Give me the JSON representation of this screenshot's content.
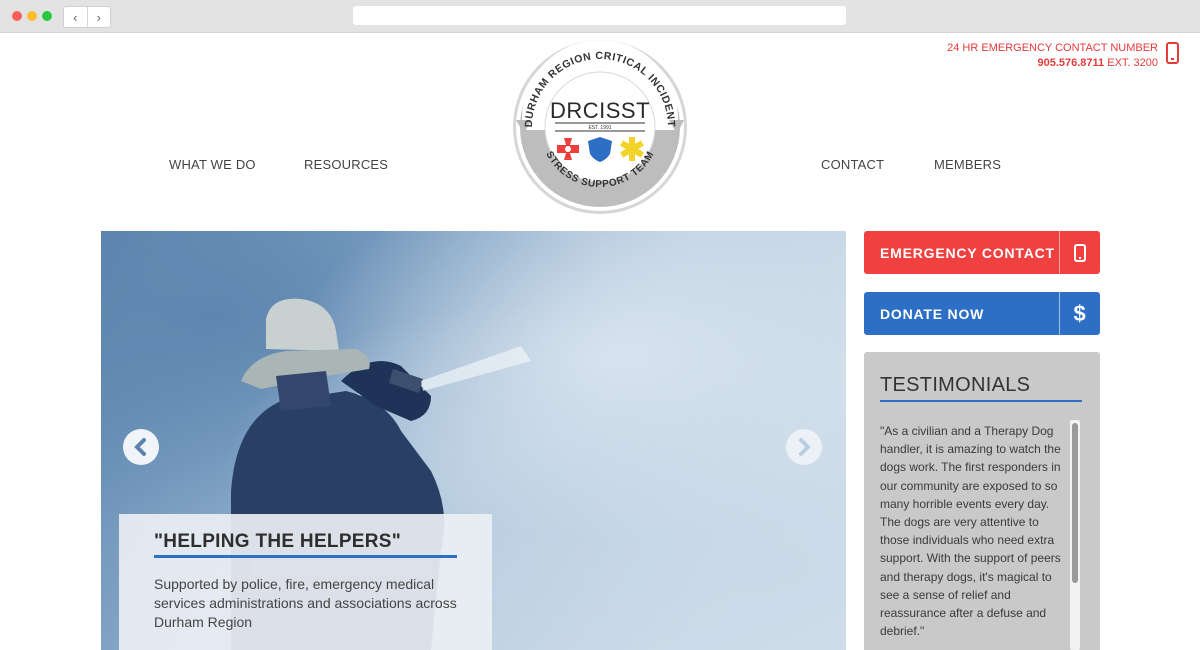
{
  "header": {
    "emergency_label": "24 HR EMERGENCY CONTACT NUMBER",
    "emergency_number": "905.576.8711",
    "emergency_ext": "EXT. 3200"
  },
  "logo": {
    "arc_top": "DURHAM REGION CRITICAL INCIDENT",
    "name": "DRCISST",
    "est": "EST. 1991",
    "arc_bottom": "STRESS SUPPORT TEAM"
  },
  "nav": {
    "items": [
      {
        "label": "WHAT WE DO"
      },
      {
        "label": "RESOURCES"
      },
      {
        "label": "CONTACT"
      },
      {
        "label": "MEMBERS"
      }
    ]
  },
  "hero": {
    "title": "\"HELPING THE HELPERS\"",
    "text": "Supported by police, fire, emergency medical services administrations and associations across Durham Region"
  },
  "sidebar": {
    "emergency_button": "EMERGENCY CONTACT",
    "donate_button": "DONATE NOW",
    "testimonials_title": "TESTIMONIALS",
    "testimonial_text": "\"As a civilian and a Therapy Dog handler, it is amazing to watch the dogs work. The first responders in our community are exposed to so many horrible events every day. The dogs are very attentive to those individuals who need extra support. With the support of peers and therapy dogs, it's magical to see a sense of relief and reassurance after a defuse and debrief.\""
  },
  "colors": {
    "accent_red": "#f0403f",
    "accent_blue": "#2c6fc4",
    "sidebar_gray": "#c9c9c9"
  },
  "icons": [
    "back-arrow-icon",
    "forward-arrow-icon",
    "phone-icon",
    "dollar-icon",
    "prev-slide-icon",
    "next-slide-icon"
  ]
}
